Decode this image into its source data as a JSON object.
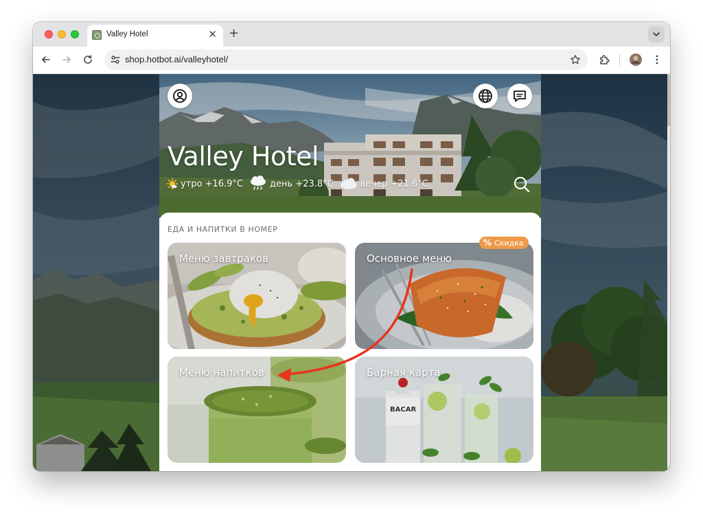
{
  "browser": {
    "tab_title": "Valley Hotel",
    "tab_close": "✕",
    "new_tab": "+",
    "url_domain": "shop.hotbot.ai",
    "url_path": "/valleyhotel/"
  },
  "hero": {
    "hotel_name": "Valley Hotel",
    "weather": {
      "morning": "утро +16.9°C",
      "day": "день +23.8°C",
      "evening": "вечер +21.6°C"
    }
  },
  "section": {
    "title": "ЕДА И НАПИТКИ В НОМЕР",
    "badge": "Скидка",
    "badge_symbol": "%"
  },
  "cards": [
    {
      "label": "Меню завтраков"
    },
    {
      "label": "Основное меню"
    },
    {
      "label": "Меню напитков"
    },
    {
      "label": "Барная карта"
    }
  ],
  "bottle_text": "BACAR",
  "colors": {
    "badge": "#ef9a48",
    "annotation_arrow": "#e8341c"
  }
}
